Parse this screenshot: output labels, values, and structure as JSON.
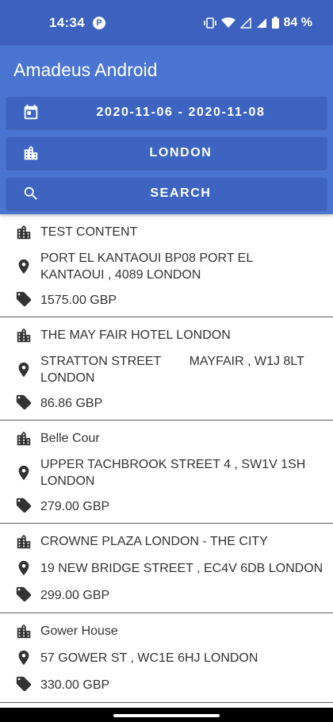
{
  "status_bar": {
    "time": "14:34",
    "icon_p": "P",
    "battery": "84 %"
  },
  "app": {
    "title": "Amadeus Android",
    "accent": "#4a74d2"
  },
  "filters": {
    "dates": "2020-11-06 - 2020-11-08",
    "city": "LONDON",
    "search": "SEARCH"
  },
  "hotels": [
    {
      "name": "TEST CONTENT",
      "address": "PORT EL KANTAOUI BP08 PORT EL\nKANTAOUI , 4089 LONDON",
      "price": "1575.00 GBP"
    },
    {
      "name": "THE MAY FAIR HOTEL LONDON",
      "address": "STRATTON STREET        MAYFAIR , W1J 8LT\nLONDON",
      "price": "86.86 GBP"
    },
    {
      "name": "Belle Cour",
      "address": "UPPER TACHBROOK STREET 4 , SW1V 1SH\nLONDON",
      "price": "279.00 GBP"
    },
    {
      "name": "CROWNE PLAZA LONDON - THE CITY",
      "address": "19 NEW BRIDGE STREET , EC4V 6DB LONDON",
      "price": "299.00 GBP"
    },
    {
      "name": "Gower House",
      "address": "57 GOWER ST , WC1E 6HJ LONDON",
      "price": "330.00 GBP"
    }
  ]
}
